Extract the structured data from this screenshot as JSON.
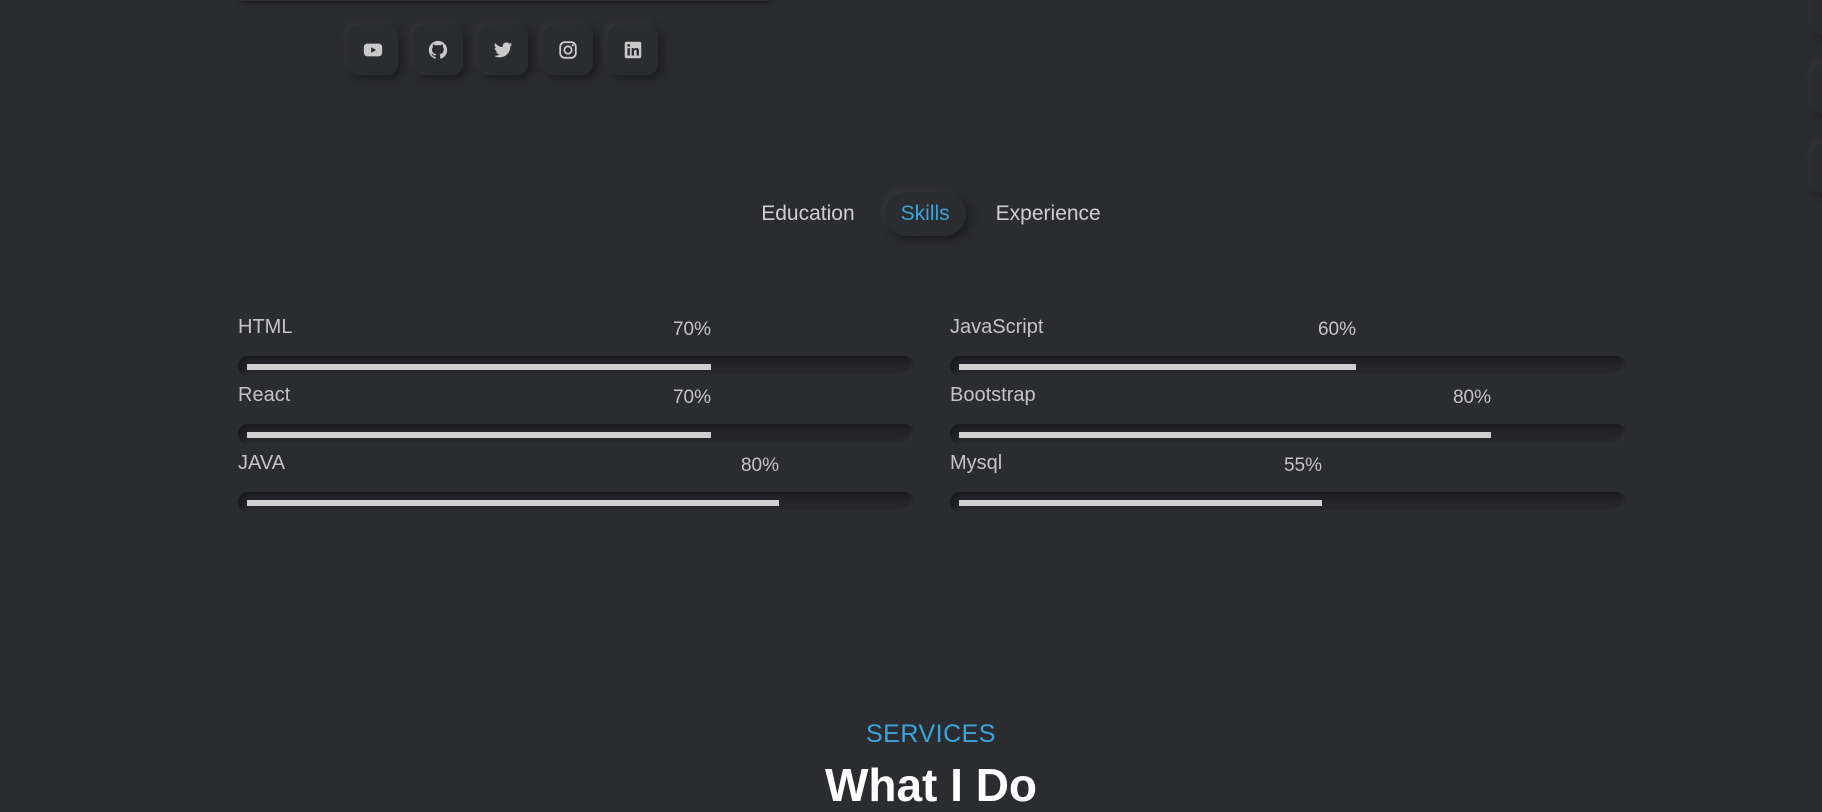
{
  "social": {
    "items": [
      {
        "name": "youtube-icon"
      },
      {
        "name": "github-icon"
      },
      {
        "name": "twitter-icon"
      },
      {
        "name": "instagram-icon"
      },
      {
        "name": "linkedin-icon"
      }
    ]
  },
  "tabs": {
    "items": [
      {
        "label": "Education",
        "active": false
      },
      {
        "label": "Skills",
        "active": true
      },
      {
        "label": "Experience",
        "active": false
      }
    ]
  },
  "skills": {
    "left": [
      {
        "name": "HTML",
        "percent_label": "70%",
        "level": 0.7
      },
      {
        "name": "React",
        "percent_label": "70%",
        "level": 0.7
      },
      {
        "name": "JAVA",
        "percent_label": "80%",
        "level": 0.8
      }
    ],
    "right": [
      {
        "name": "JavaScript",
        "percent_label": "60%",
        "level": 0.6
      },
      {
        "name": "Bootstrap",
        "percent_label": "80%",
        "level": 0.8
      },
      {
        "name": "Mysql",
        "percent_label": "55%",
        "level": 0.55
      }
    ]
  },
  "services": {
    "label": "SERVICES",
    "title": "What I Do"
  },
  "colors": {
    "background": "#2b2c30",
    "accent": "#3aa5dc",
    "bar_fill": "#cfcfcf",
    "text": "#c8c8c8",
    "heading": "#ffffff"
  }
}
